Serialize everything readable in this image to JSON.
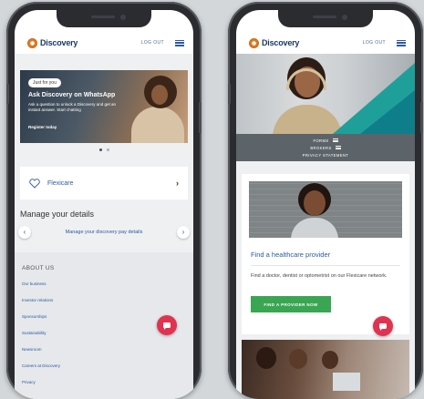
{
  "left_phone": {
    "header": {
      "brand": "Discovery",
      "logout_label": "LOG OUT"
    },
    "banner": {
      "tag": "Just for you",
      "title": "Ask Discovery on WhatsApp",
      "text": "Ask a question to unlock a Discovery and get an instant answer. Start chatting",
      "link": "Register today"
    },
    "carousel": {
      "page_count": 2,
      "active_index": 0
    },
    "flexicare": {
      "label": "Flexicare",
      "chevron": "›"
    },
    "manage": {
      "title": "Manage your details",
      "link": "Manage your discovery pay details",
      "prev": "‹",
      "next": "›"
    },
    "footer": {
      "title": "ABOUT US",
      "links": [
        "Our business",
        "Investor relations",
        "Sponsorships",
        "Sustainability",
        "Newsroom",
        "Careers at Discovery",
        "Privacy"
      ]
    }
  },
  "right_phone": {
    "header": {
      "brand": "Discovery",
      "logout_label": "LOG OUT"
    },
    "menu": {
      "items": [
        "FORMS",
        "BROKERS",
        "PRIVACY STATEMENT"
      ]
    },
    "card": {
      "title": "Find a healthcare provider",
      "text": "Find a doctor, dentist or optometrist on our Flexicare network.",
      "button": "FIND A PROVIDER NOW"
    }
  },
  "colors": {
    "brand_blue": "#2c5aa0",
    "chat_red": "#e0334f",
    "cta_green": "#3aa552",
    "accent_teal": "#1f9f9a"
  }
}
